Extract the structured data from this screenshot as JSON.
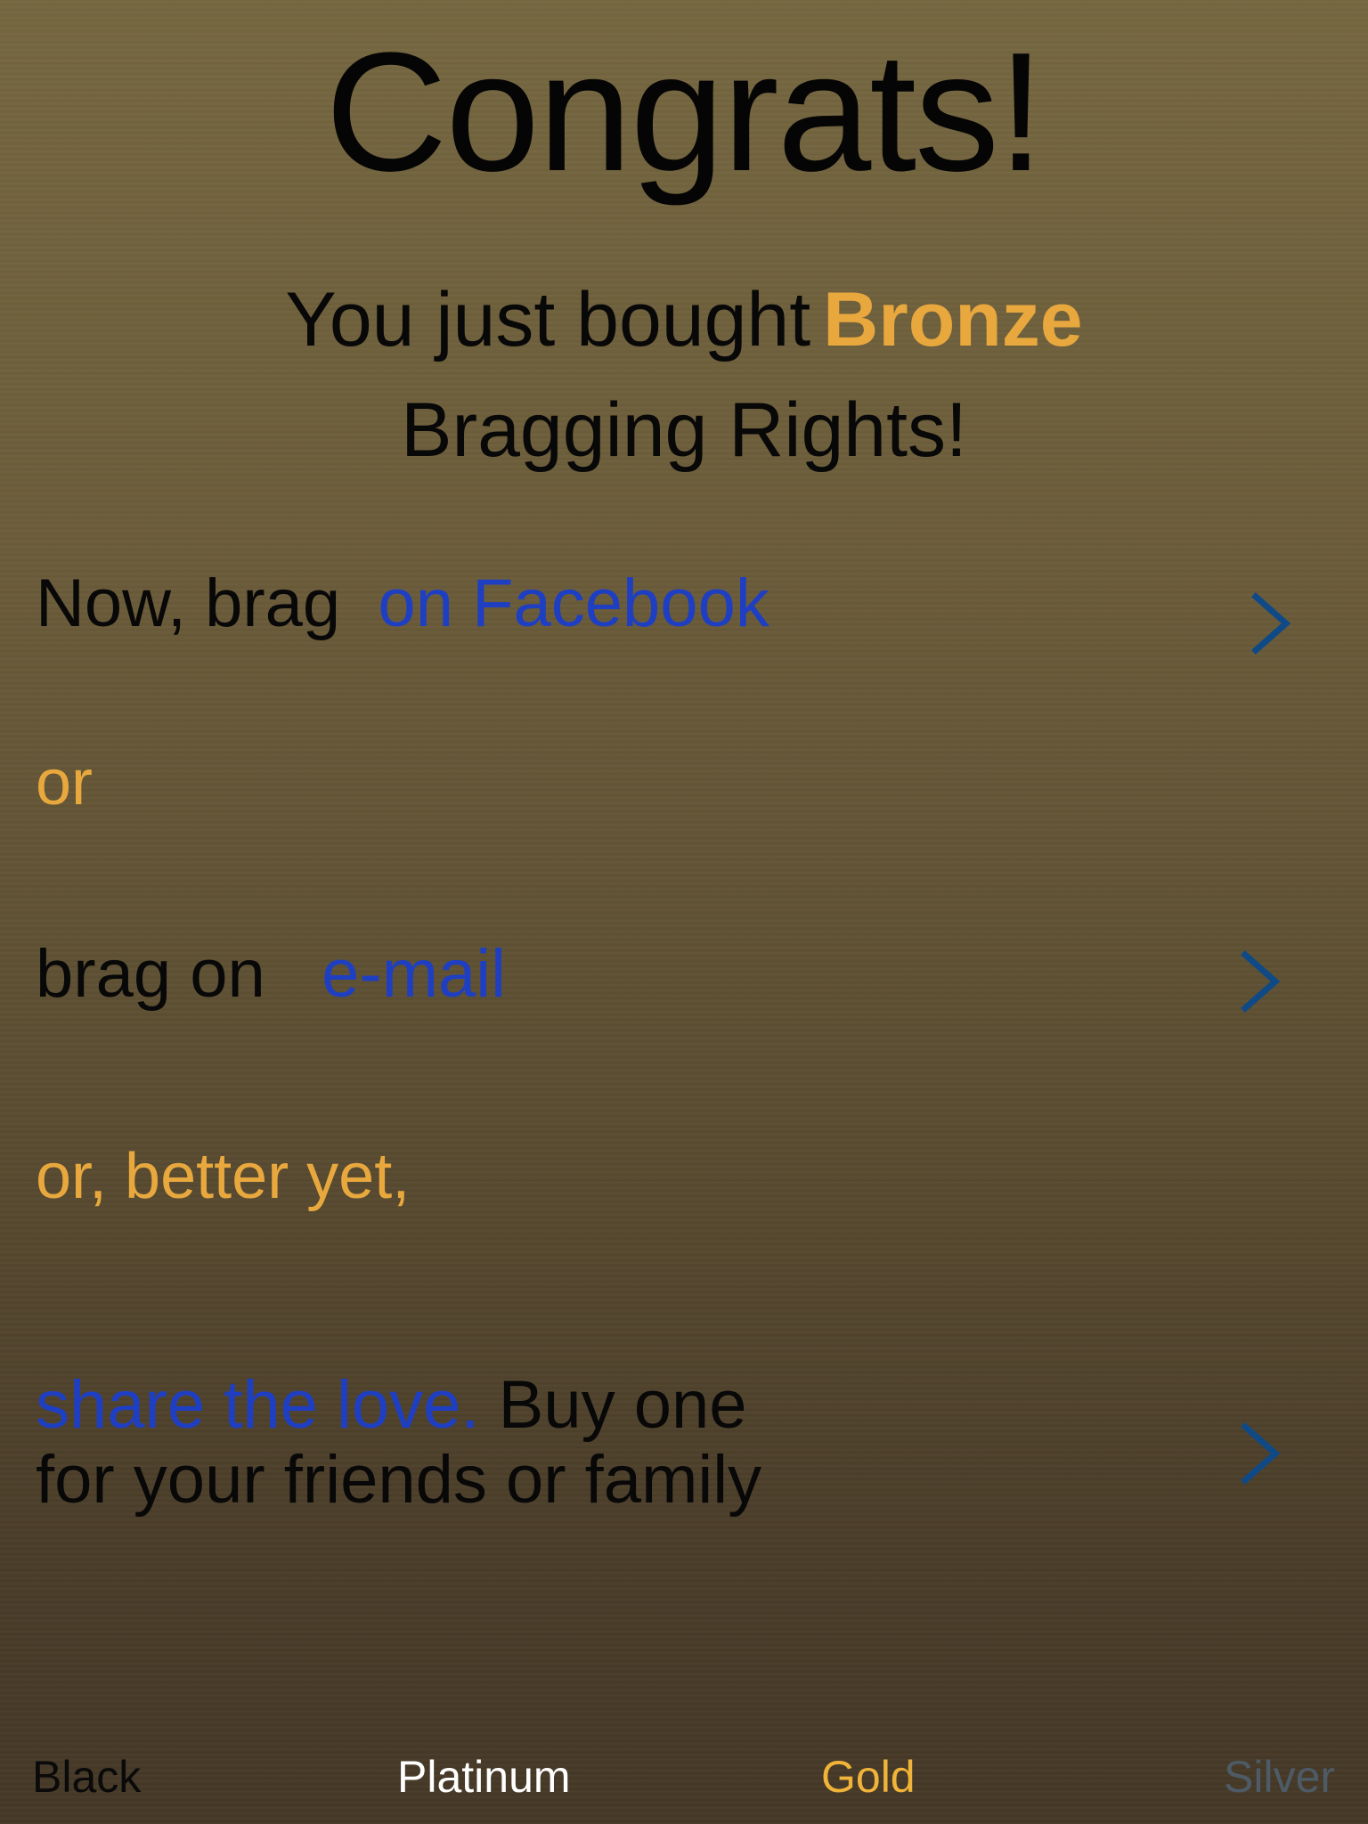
{
  "header": {
    "title": "Congrats!",
    "subtitle_prefix": "You just bought",
    "tier": "Bronze",
    "subtitle_line2": "Bragging Rights!"
  },
  "options": {
    "facebook": {
      "prefix": "Now, brag",
      "link": "on Facebook"
    },
    "or1": "or",
    "email": {
      "prefix": "brag on",
      "link": "e-mail"
    },
    "or2": "or, better yet,",
    "share": {
      "link": "share the love.",
      "suffix": "Buy one",
      "line2": "for your friends or family"
    }
  },
  "icons": {
    "chevron": "chevron-right-icon"
  },
  "tabs": [
    {
      "label": "Black",
      "color": "#0a0a0a"
    },
    {
      "label": "Platinum",
      "color": "#ffffff"
    },
    {
      "label": "Gold",
      "color": "#f0b43a"
    },
    {
      "label": "Silver",
      "color": "#4d5b66"
    }
  ],
  "colors": {
    "accent_gold": "#e8a83e",
    "link_blue": "#1f3fc2",
    "chevron_blue": "#0f4a86"
  }
}
